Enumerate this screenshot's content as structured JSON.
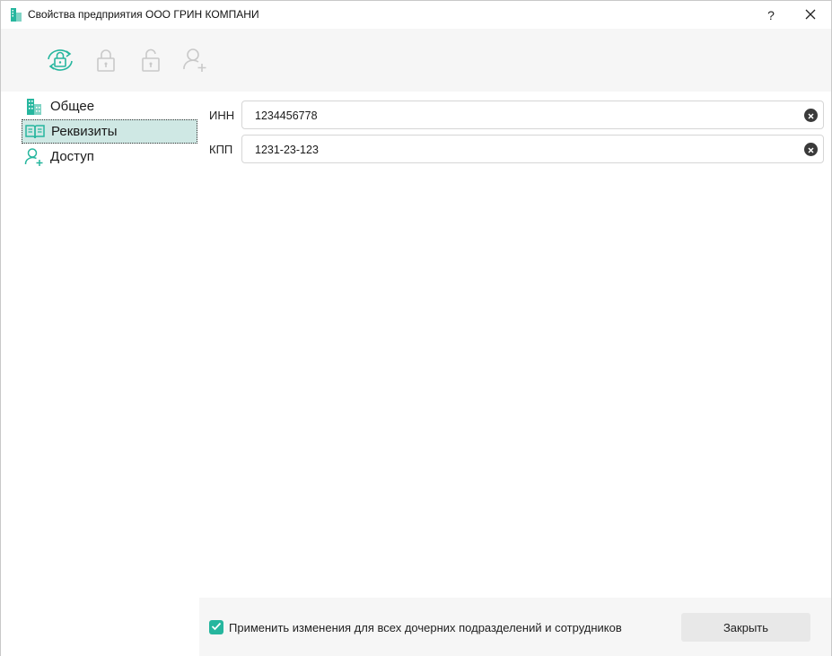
{
  "window": {
    "title": "Свойства предприятия ООО ГРИН КОМПАНИ"
  },
  "titlebar": {
    "help_label": "?",
    "close_label": "✕"
  },
  "toolbar": {
    "icons": [
      "refresh-lock-icon",
      "lock-icon",
      "unlock-icon",
      "add-user-icon"
    ]
  },
  "sidebar": {
    "items": [
      {
        "label": "Общее",
        "icon": "building-icon"
      },
      {
        "label": "Реквизиты",
        "icon": "book-icon"
      },
      {
        "label": "Доступ",
        "icon": "add-user-icon"
      }
    ],
    "selected": "Реквизиты"
  },
  "fields": [
    {
      "label": "ИНН",
      "value": "1234456778"
    },
    {
      "label": "КПП",
      "value": "1231-23-123"
    }
  ],
  "footer": {
    "apply_all_checked": true,
    "apply_all_label": "Применить изменения для всех дочерних подразделений и сотрудников",
    "close_label": "Закрыть"
  },
  "colors": {
    "accent": "#26b69e",
    "selected_bg": "#cfe8e4",
    "disabled_icon": "#c9c9c9"
  }
}
